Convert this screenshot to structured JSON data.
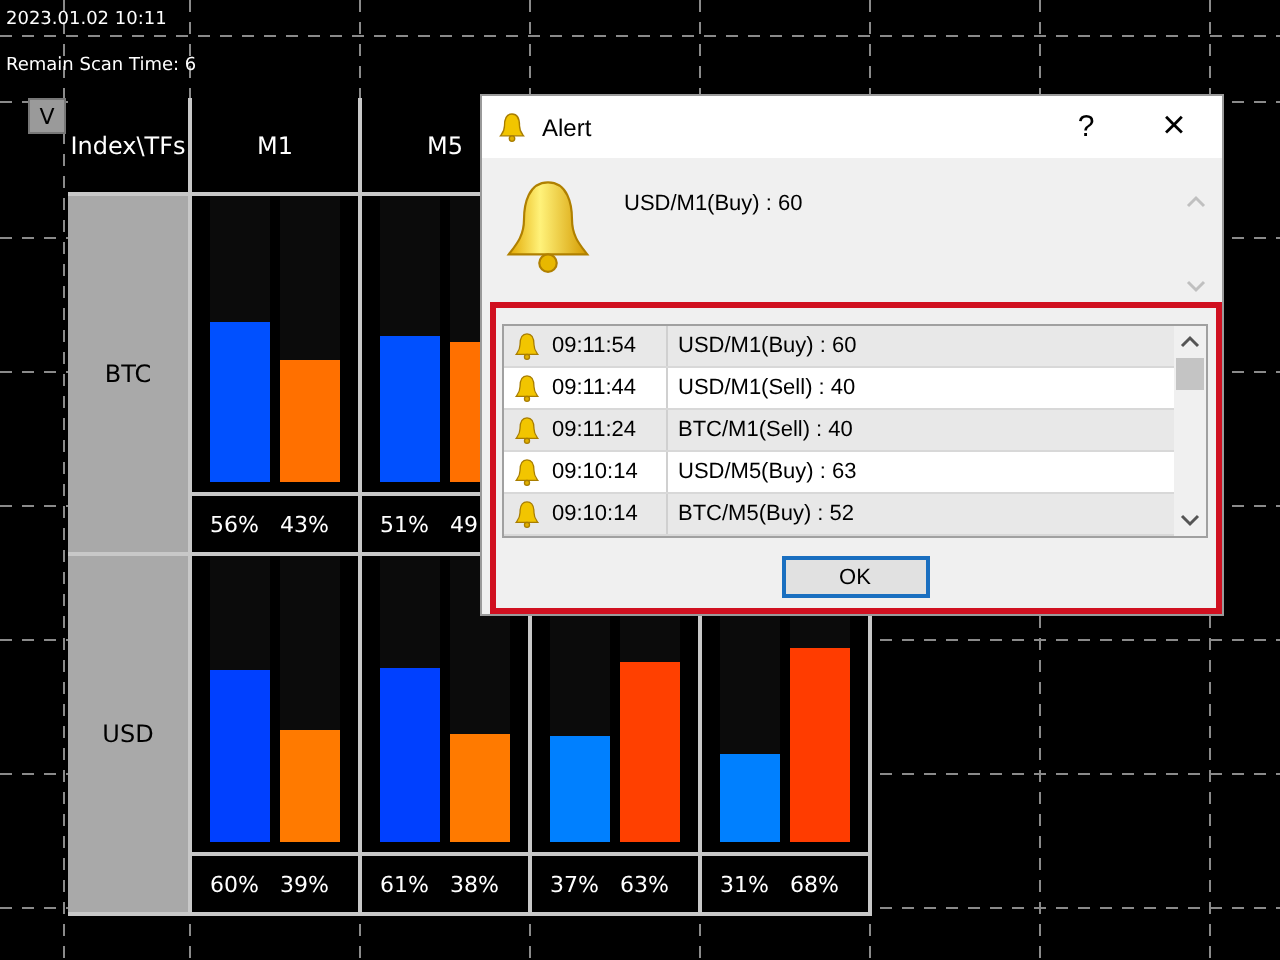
{
  "timestamp": "2023.01.02 10:11",
  "scan_status": "Remain Scan Time: 6",
  "toggle_button": "V",
  "table": {
    "corner": "Index\\TFs",
    "columns": [
      "M1",
      "M5"
    ],
    "rows": [
      {
        "name": "BTC",
        "cells": [
          {
            "bars": [
              {
                "level": 0.56,
                "color": "#0050ff"
              },
              {
                "level": 0.43,
                "color": "#ff7000"
              }
            ],
            "labels": [
              "56%",
              "43%"
            ]
          },
          {
            "bars": [
              {
                "level": 0.51,
                "color": "#0050ff"
              },
              {
                "level": 0.49,
                "color": "#ff7000"
              }
            ],
            "labels": [
              "51%",
              "49"
            ]
          }
        ]
      },
      {
        "name": "USD",
        "cells": [
          {
            "bars": [
              {
                "level": 0.6,
                "color": "#0040ff"
              },
              {
                "level": 0.39,
                "color": "#ff7a00"
              }
            ],
            "labels": [
              "60%",
              "39%"
            ]
          },
          {
            "bars": [
              {
                "level": 0.61,
                "color": "#0040ff"
              },
              {
                "level": 0.38,
                "color": "#ff7a00"
              }
            ],
            "labels": [
              "61%",
              "38%"
            ]
          },
          {
            "bars": [
              {
                "level": 0.37,
                "color": "#0080ff"
              },
              {
                "level": 0.63,
                "color": "#ff4000"
              }
            ],
            "labels": [
              "37%",
              "63%"
            ]
          },
          {
            "bars": [
              {
                "level": 0.31,
                "color": "#0080ff"
              },
              {
                "level": 0.68,
                "color": "#ff3c00"
              }
            ],
            "labels": [
              "31%",
              "68%"
            ]
          }
        ]
      }
    ]
  },
  "dialog": {
    "title": "Alert",
    "help": "?",
    "close": "×",
    "message": "USD/M1(Buy) : 60",
    "log": [
      {
        "time": "09:11:54",
        "message": "USD/M1(Buy) : 60"
      },
      {
        "time": "09:11:44",
        "message": "USD/M1(Sell) : 40"
      },
      {
        "time": "09:11:24",
        "message": "BTC/M1(Sell) : 40"
      },
      {
        "time": "09:10:14",
        "message": "USD/M5(Buy) : 63"
      },
      {
        "time": "09:10:14",
        "message": "BTC/M5(Buy) : 52"
      }
    ],
    "ok": "OK"
  }
}
